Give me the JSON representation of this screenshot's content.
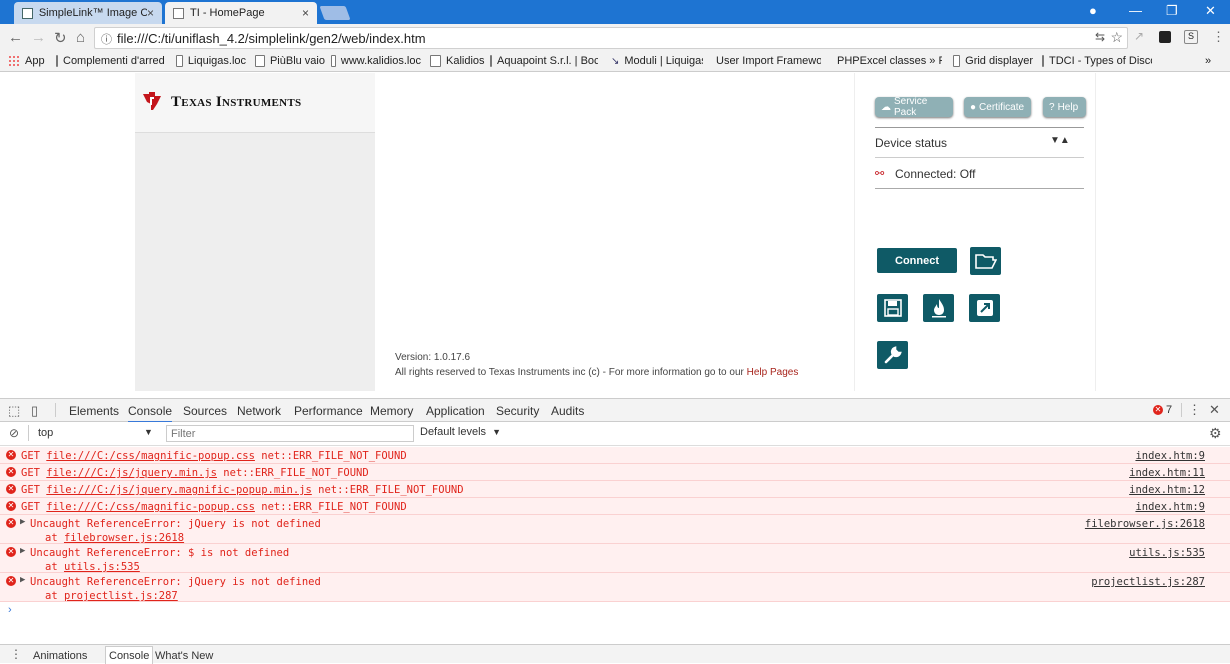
{
  "browser": {
    "tabs": [
      {
        "title": "SimpleLink™ Image Crea",
        "active": false
      },
      {
        "title": "TI - HomePage",
        "active": true
      }
    ],
    "url": "file:///C:/ti/uniflash_4.2/simplelink/gen2/web/index.htm",
    "bookmarks": [
      "App",
      "Complementi d'arred",
      "Liquigas.loc",
      "PiùBlu vaio",
      "www.kalidios.loc",
      "Kalidios",
      "Aquapoint S.r.l. | Boc",
      "Moduli | Liquigas",
      "User Import Framewo",
      "PHPExcel classes » Ph",
      "Grid displayer",
      "TDCI - Types of Disco"
    ],
    "more_bookmarks": "»"
  },
  "page": {
    "logo_text": "Texas Instruments",
    "buttons": {
      "service_pack": "Service Pack",
      "certificate": "Certificate",
      "help": "Help",
      "connect": "Connect"
    },
    "device_status_label": "Device status",
    "connection_status": "Connected: Off",
    "version": "Version: 1.0.17.6",
    "rights_text": "All rights reserved to Texas Instruments inc (c) - For more information go to our",
    "help_link": "Help Pages"
  },
  "devtools": {
    "tabs": [
      "Elements",
      "Console",
      "Sources",
      "Network",
      "Performance",
      "Memory",
      "Application",
      "Security",
      "Audits"
    ],
    "active_tab": "Console",
    "error_count": "7",
    "context": "top",
    "filter_placeholder": "Filter",
    "levels": "Default levels",
    "logs": [
      {
        "msg": "GET ",
        "url": "file:///C:/css/magnific-popup.css",
        "err": " net::ERR_FILE_NOT_FOUND",
        "src": "index.htm:9"
      },
      {
        "msg": "GET ",
        "url": "file:///C:/js/jquery.min.js",
        "err": " net::ERR_FILE_NOT_FOUND",
        "src": "index.htm:11"
      },
      {
        "msg": "GET ",
        "url": "file:///C:/js/jquery.magnific-popup.min.js",
        "err": " net::ERR_FILE_NOT_FOUND",
        "src": "index.htm:12"
      },
      {
        "msg": "GET ",
        "url": "file:///C:/css/magnific-popup.css",
        "err": " net::ERR_FILE_NOT_FOUND",
        "src": "index.htm:9"
      }
    ],
    "exceptions": [
      {
        "msg": "Uncaught ReferenceError: jQuery is not defined",
        "at": "filebrowser.js:2618",
        "src": "filebrowser.js:2618"
      },
      {
        "msg": "Uncaught ReferenceError: $ is not defined",
        "at": "utils.js:535",
        "src": "utils.js:535"
      },
      {
        "msg": "Uncaught ReferenceError: jQuery is not defined",
        "at": "projectlist.js:287",
        "src": "projectlist.js:287"
      }
    ],
    "at_prefix": "at ",
    "drawer_tabs": [
      "Animations",
      "Console",
      "What's New"
    ]
  },
  "colors": {
    "ti_red": "#c4161c",
    "teal": "#0f5a66",
    "error_red": "#e0241b",
    "chrome_blue": "#1e74d2"
  }
}
